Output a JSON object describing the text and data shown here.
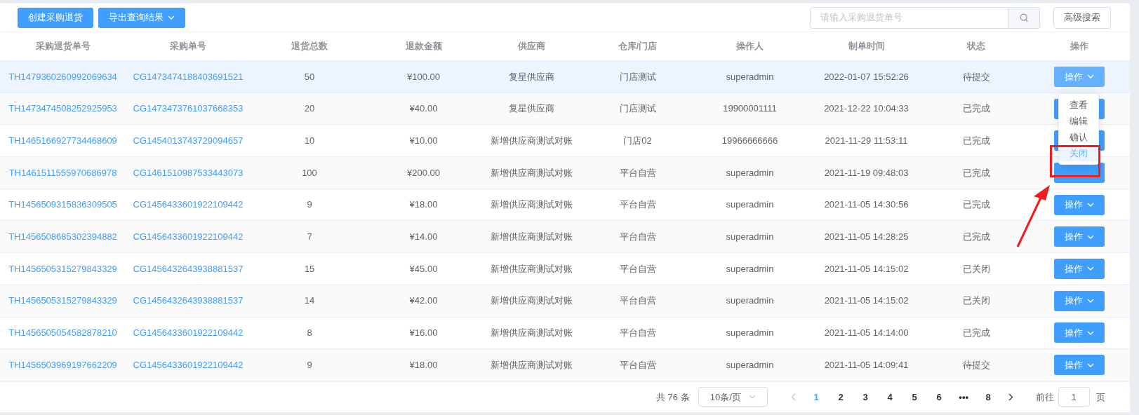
{
  "toolbar": {
    "buttons": [
      {
        "label": "创建采购退货",
        "dropdown": false
      },
      {
        "label": "导出查询结果",
        "dropdown": true
      }
    ],
    "search": {
      "placeholder": "请输入采购退货单号"
    },
    "advanced_button": "高级搜索"
  },
  "table": {
    "columns": [
      "采购退货单号",
      "采购单号",
      "退货总数",
      "退款金额",
      "供应商",
      "仓库/门店",
      "操作人",
      "制单时间",
      "状态",
      "操作"
    ],
    "rows": [
      {
        "return_no": "TH1479360260992069634",
        "order_no": "CG1473474188403691521",
        "qty": "50",
        "amount": "¥100.00",
        "supplier": "复星供应商",
        "store": "门店测试",
        "operator": "superadmin",
        "time": "2022-01-07 15:52:26",
        "status": "待提交",
        "action": "操作",
        "highlighted": true
      },
      {
        "return_no": "TH1473474508252925953",
        "order_no": "CG1473473761037668353",
        "qty": "20",
        "amount": "¥40.00",
        "supplier": "复星供应商",
        "store": "门店测试",
        "operator": "19900001111",
        "time": "2021-12-22 10:04:33",
        "status": "已完成",
        "highlighted": false
      },
      {
        "return_no": "TH1465166927734468609",
        "order_no": "CG1454013743729094657",
        "qty": "10",
        "amount": "¥10.00",
        "supplier": "新增供应商测试对账",
        "store": "门店02",
        "operator": "19966666666",
        "time": "2021-11-29 11:53:11",
        "status": "已完成",
        "highlighted": false
      },
      {
        "return_no": "TH1461511555970686978",
        "order_no": "CG1461510987533443073",
        "qty": "100",
        "amount": "¥200.00",
        "supplier": "新增供应商测试对账",
        "store": "平台自营",
        "operator": "superadmin",
        "time": "2021-11-19 09:48:03",
        "status": "已完成",
        "highlighted": false
      },
      {
        "return_no": "TH1456509315836309505",
        "order_no": "CG1456433601922109442",
        "qty": "9",
        "amount": "¥18.00",
        "supplier": "新增供应商测试对账",
        "store": "平台自营",
        "operator": "superadmin",
        "time": "2021-11-05 14:30:56",
        "status": "已完成",
        "action": "操作",
        "highlighted": false
      },
      {
        "return_no": "TH1456508685302394882",
        "order_no": "CG1456433601922109442",
        "qty": "7",
        "amount": "¥14.00",
        "supplier": "新增供应商测试对账",
        "store": "平台自营",
        "operator": "superadmin",
        "time": "2021-11-05 14:28:25",
        "status": "已完成",
        "action": "操作",
        "highlighted": false
      },
      {
        "return_no": "TH1456505315279843329",
        "order_no": "CG1456432643938881537",
        "qty": "15",
        "amount": "¥45.00",
        "supplier": "新增供应商测试对账",
        "store": "平台自营",
        "operator": "superadmin",
        "time": "2021-11-05 14:15:02",
        "status": "已关闭",
        "action": "操作",
        "highlighted": false
      },
      {
        "return_no": "TH1456505315279843329",
        "order_no": "CG1456432643938881537",
        "qty": "14",
        "amount": "¥42.00",
        "supplier": "新增供应商测试对账",
        "store": "平台自营",
        "operator": "superadmin",
        "time": "2021-11-05 14:15:02",
        "status": "已关闭",
        "action": "操作",
        "highlighted": false
      },
      {
        "return_no": "TH1456505054582878210",
        "order_no": "CG1456433601922109442",
        "qty": "8",
        "amount": "¥16.00",
        "supplier": "新增供应商测试对账",
        "store": "平台自营",
        "operator": "superadmin",
        "time": "2021-11-05 14:14:00",
        "status": "已完成",
        "action": "操作",
        "highlighted": false
      },
      {
        "return_no": "TH1456503969197662209",
        "order_no": "CG1456433601922109442",
        "qty": "9",
        "amount": "¥18.00",
        "supplier": "新增供应商测试对账",
        "store": "平台自营",
        "operator": "superadmin",
        "time": "2021-11-05 14:09:41",
        "status": "待提交",
        "action": "操作",
        "highlighted": false
      }
    ]
  },
  "action_menu": {
    "items": [
      {
        "label": "查看",
        "hovered": false
      },
      {
        "label": "编辑",
        "hovered": false
      },
      {
        "label": "确认",
        "hovered": false
      },
      {
        "label": "关闭",
        "hovered": true
      }
    ]
  },
  "pagination": {
    "total": "共 76 条",
    "page_size": "10条/页",
    "pages": [
      {
        "label": "1",
        "selected": true
      },
      {
        "label": "2",
        "selected": false
      },
      {
        "label": "3",
        "selected": false
      },
      {
        "label": "4",
        "selected": false
      },
      {
        "label": "5",
        "selected": false
      },
      {
        "label": "6",
        "selected": false
      },
      {
        "label": "•••",
        "selected": false
      },
      {
        "label": "8",
        "selected": false
      }
    ],
    "goto_label": "前往",
    "goto_value": "1",
    "goto_suffix": "页"
  }
}
